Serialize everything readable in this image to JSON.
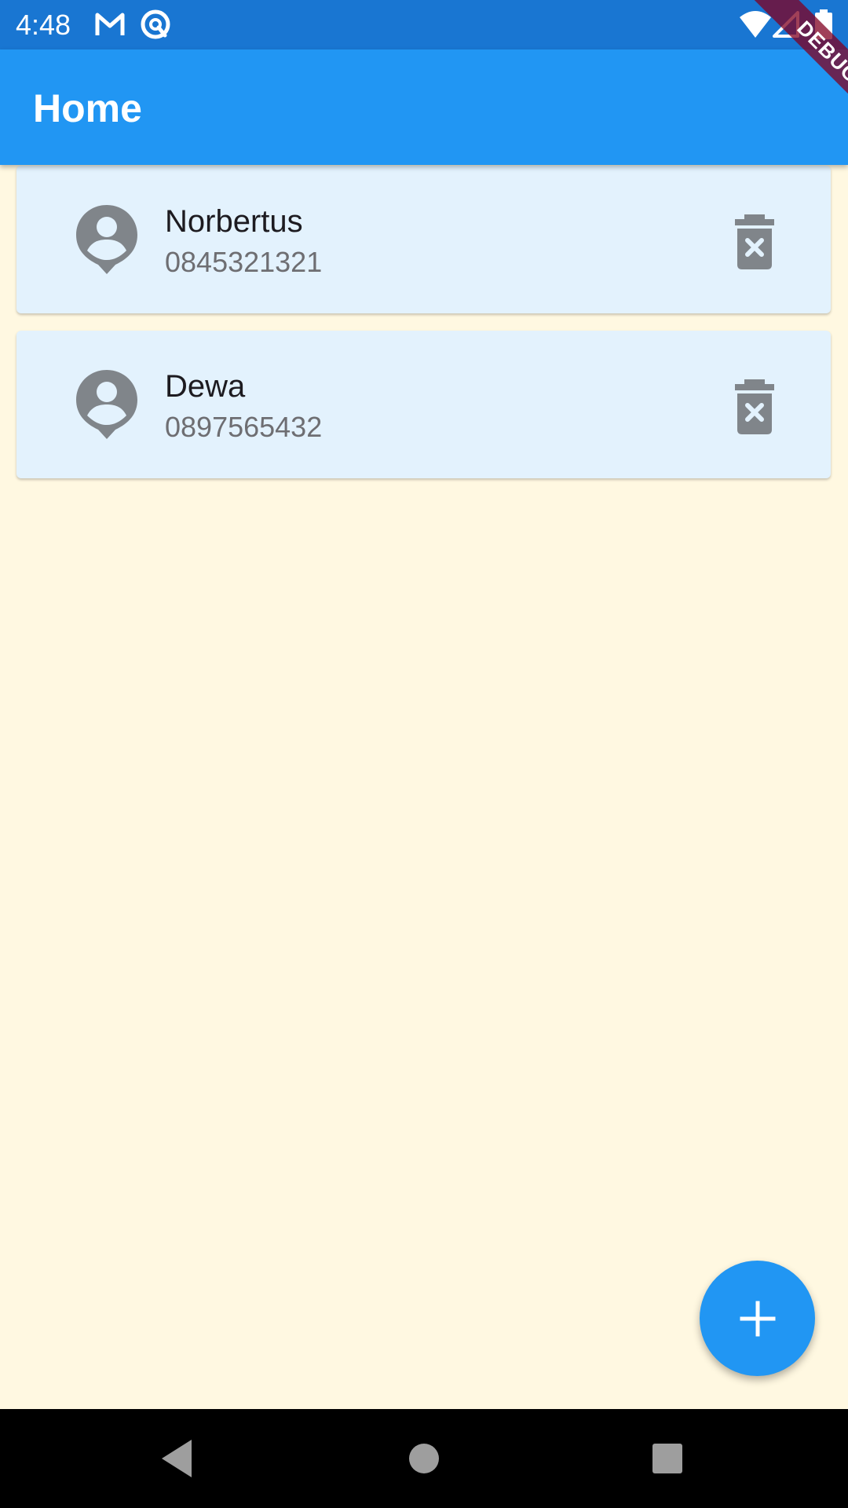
{
  "status_bar": {
    "time": "4:48",
    "icons": [
      "gmail-icon",
      "app-notification-icon",
      "wifi-icon",
      "signal-icon",
      "battery-icon"
    ]
  },
  "debug_banner": {
    "label": "DEBUG"
  },
  "app_bar": {
    "title": "Home"
  },
  "contacts": [
    {
      "name": "Norbertus",
      "phone": "0845321321",
      "avatar_icon": "person-pin-icon",
      "action_icon": "delete-forever-icon"
    },
    {
      "name": "Dewa",
      "phone": "0897565432",
      "avatar_icon": "person-pin-icon",
      "action_icon": "delete-forever-icon"
    }
  ],
  "fab": {
    "icon": "add-icon"
  },
  "nav_bar": {
    "icons": [
      "back-icon",
      "home-icon",
      "recents-icon"
    ]
  },
  "colors": {
    "status_bar": "#1976D2",
    "app_bar": "#2196F3",
    "background": "#FFF8E1",
    "card": "#E3F2FD",
    "icon_grey": "#80858A",
    "fab": "#2196F3"
  }
}
